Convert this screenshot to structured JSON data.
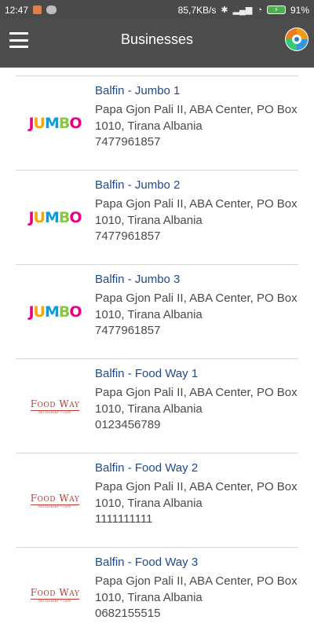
{
  "status_bar": {
    "time": "12:47",
    "net_speed": "85,7KB/s",
    "battery": "91%"
  },
  "app_bar": {
    "title": "Businesses",
    "menu_icon": "hamburger-menu-icon",
    "logo_icon": "app-logo-icon"
  },
  "businesses": [
    {
      "name": "Balfin - Jumbo 1",
      "address": "Papa Gjon Pali II, ABA Center, PO Box 1010, Tirana Albania",
      "phone": "7477961857",
      "logo_text": "JUMBO"
    },
    {
      "name": "Balfin - Jumbo 2",
      "address": "Papa Gjon Pali II, ABA Center, PO Box 1010, Tirana Albania",
      "phone": "7477961857",
      "logo_text": "JUMBO"
    },
    {
      "name": "Balfin - Jumbo 3",
      "address": "Papa Gjon Pali II, ABA Center, PO Box 1010, Tirana Albania",
      "phone": "7477961857",
      "logo_text": "JUMBO"
    },
    {
      "name": "Balfin - Food Way 1",
      "address": "Papa Gjon Pali II, ABA Center, PO Box 1010, Tirana Albania",
      "phone": "0123456789",
      "logo_text": "FOOD WAY"
    },
    {
      "name": "Balfin - Food Way 2",
      "address": "Papa Gjon Pali II, ABA Center, PO Box 1010, Tirana Albania",
      "phone": "1111111111",
      "logo_text": "FOOD WAY"
    },
    {
      "name": "Balfin - Food Way 3",
      "address": "Papa Gjon Pali II, ABA Center, PO Box 1010, Tirana Albania",
      "phone": "0682155515",
      "logo_text": "FOOD WAY"
    }
  ],
  "colors": {
    "app_bar": "#4d4d4d",
    "status_bar": "#4a4a4a",
    "title_text": "#1e4a8a",
    "body_text": "#4a4a4a",
    "jumbo_letters": [
      "#e6007e",
      "#f7a600",
      "#009fe3",
      "#8cc63f",
      "#e6007e"
    ],
    "food_way": "#c0392b"
  }
}
